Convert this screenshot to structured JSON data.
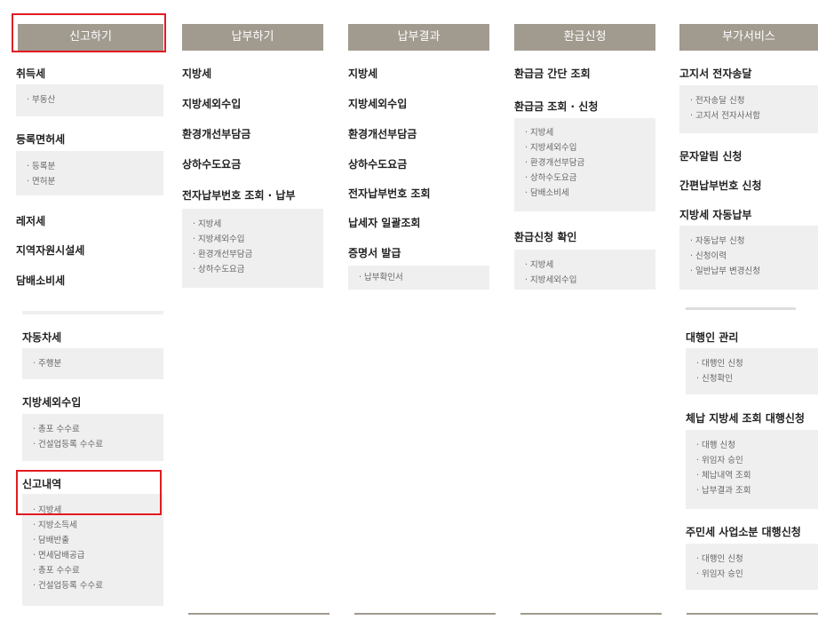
{
  "tabs": [
    "신고하기",
    "납부하기",
    "납부결과",
    "환급신청",
    "부가서비스"
  ],
  "col1": {
    "s0": {
      "title": "취득세",
      "items": [
        "부동산"
      ]
    },
    "s1": {
      "title": "등록면허세",
      "items": [
        "등록분",
        "면허분"
      ]
    },
    "s2": {
      "title": "레저세"
    },
    "s3": {
      "title": "지역자원시설세"
    },
    "s4": {
      "title": "담배소비세"
    },
    "s5": {
      "title": "자동차세",
      "items": [
        "주행분"
      ]
    },
    "s6": {
      "title": "지방세외수입",
      "items": [
        "총포 수수료",
        "건설업등록 수수료"
      ]
    },
    "s7": {
      "title": "신고내역",
      "items": [
        "지방세",
        "지방소득세",
        "담배반출",
        "면세담배공급",
        "총포 수수료",
        "건설업등록 수수료"
      ]
    }
  },
  "col2": {
    "s0": {
      "title": "지방세"
    },
    "s1": {
      "title": "지방세외수입"
    },
    "s2": {
      "title": "환경개선부담금"
    },
    "s3": {
      "title": "상하수도요금"
    },
    "s4": {
      "title": "전자납부번호 조회 · 납부",
      "items": [
        "지방세",
        "지방세외수입",
        "환경개선부담금",
        "상하수도요금"
      ]
    }
  },
  "col3": {
    "s0": {
      "title": "지방세"
    },
    "s1": {
      "title": "지방세외수입"
    },
    "s2": {
      "title": "환경개선부담금"
    },
    "s3": {
      "title": "상하수도요금"
    },
    "s4": {
      "title": "전자납부번호 조회"
    },
    "s5": {
      "title": "납세자 일괄조회"
    },
    "s6": {
      "title": "증명서 발급",
      "items": [
        "납부확인서"
      ]
    }
  },
  "col4": {
    "s0": {
      "title": "환급금 간단 조회"
    },
    "s1": {
      "title": "환급금 조회 · 신청",
      "items": [
        "지방세",
        "지방세외수입",
        "환경개선부담금",
        "상하수도요금",
        "담배소비세"
      ]
    },
    "s2": {
      "title": "환급신청 확인",
      "items": [
        "지방세",
        "지방세외수입"
      ]
    }
  },
  "col5": {
    "s0": {
      "title": "고지서 전자송달",
      "items": [
        "전자송달 신청",
        "고지서 전자사서함"
      ]
    },
    "s1": {
      "title": "문자알림 신청"
    },
    "s2": {
      "title": "간편납부번호 신청"
    },
    "s3": {
      "title": "지방세 자동납부",
      "items": [
        "자동납부 신청",
        "신청이력",
        "일반납부 변경신청"
      ]
    },
    "s4": {
      "title": "대행인 관리",
      "items": [
        "대행인 신청",
        "신청확인"
      ]
    },
    "s5": {
      "title": "체납 지방세 조회 대행신청",
      "items": [
        "대행 신청",
        "위임자 승인",
        "체납내역 조회",
        "납부결과 조회"
      ]
    },
    "s6": {
      "title": "주민세 사업소분 대행신청",
      "items": [
        "대행인 신청",
        "위임자 승인"
      ]
    }
  }
}
